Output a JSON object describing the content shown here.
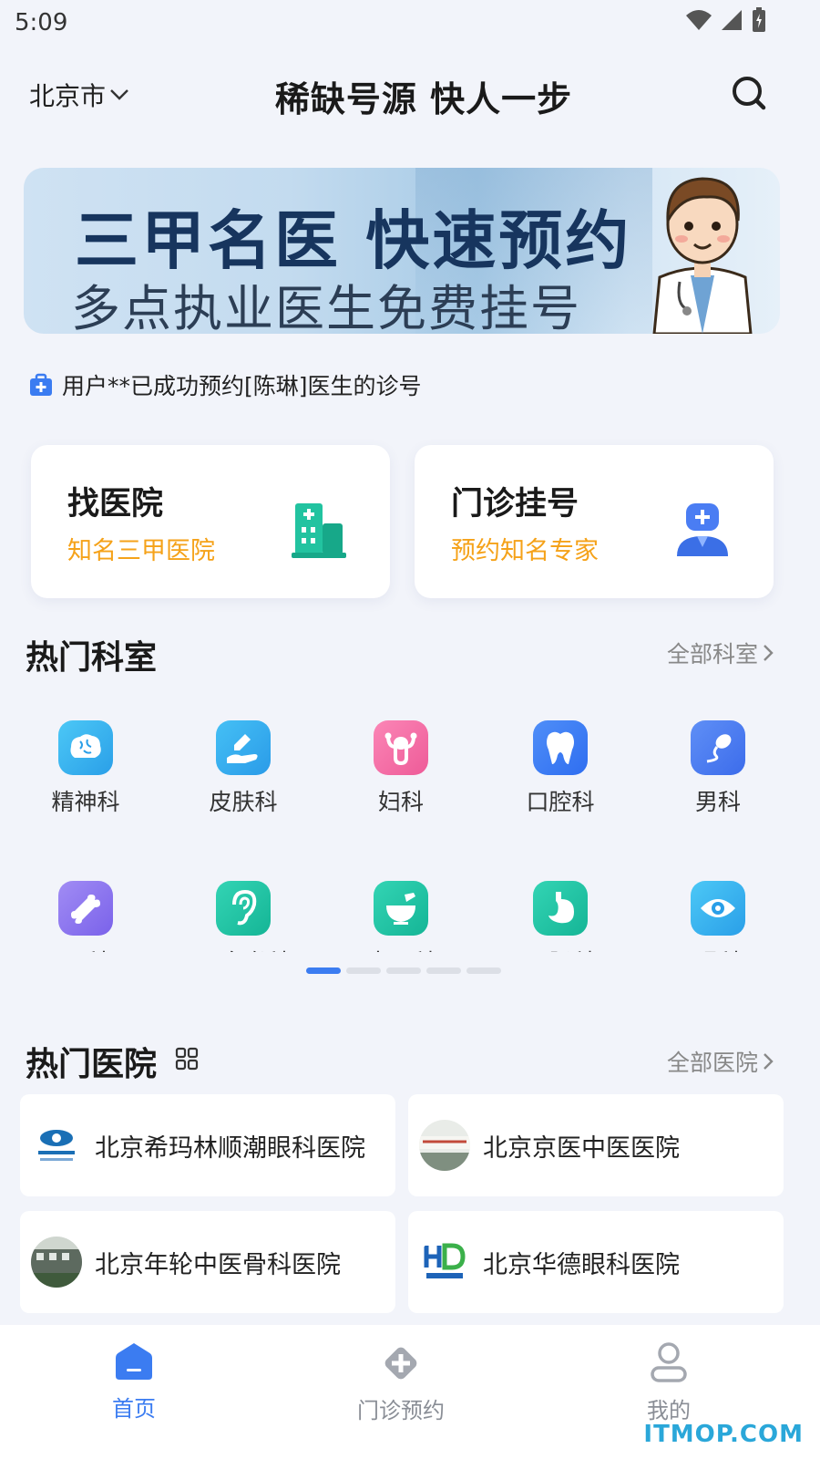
{
  "status_bar": {
    "time": "5:09"
  },
  "header": {
    "city": "北京市",
    "title": "稀缺号源 快人一步"
  },
  "banner": {
    "headline": "三甲名医 快速预约",
    "subline": "多点执业医生免费挂号"
  },
  "notice": {
    "text": "用户**已成功预约[陈琳]医生的诊号"
  },
  "quick_cards": [
    {
      "title": "找医院",
      "subtitle": "知名三甲医院",
      "icon": "hospital-building-icon"
    },
    {
      "title": "门诊挂号",
      "subtitle": "预约知名专家",
      "icon": "doctor-icon"
    }
  ],
  "departments": {
    "title": "热门科室",
    "more": "全部科室",
    "items": [
      {
        "label": "精神科",
        "icon": "brain-icon",
        "color": "#34b4f0"
      },
      {
        "label": "皮肤科",
        "icon": "skin-icon",
        "color": "#2fa8ea"
      },
      {
        "label": "妇科",
        "icon": "uterus-icon",
        "color": "#f46da3"
      },
      {
        "label": "口腔科",
        "icon": "tooth-icon",
        "color": "#3d7df5"
      },
      {
        "label": "男科",
        "icon": "sperm-icon",
        "color": "#4a7df3"
      },
      {
        "label": "骨科",
        "icon": "bone-icon",
        "color": "#8c73ee"
      },
      {
        "label": "耳鼻喉科",
        "icon": "ear-icon",
        "color": "#1fc3a5"
      },
      {
        "label": "中医科",
        "icon": "mortar-icon",
        "color": "#1fc3a5"
      },
      {
        "label": "胃肠科",
        "icon": "stomach-icon",
        "color": "#1fc3a5"
      },
      {
        "label": "眼科",
        "icon": "eye-icon",
        "color": "#38b8f2"
      }
    ],
    "page_count": 5,
    "active_page": 0
  },
  "hospitals": {
    "title": "热门医院",
    "more": "全部医院",
    "items": [
      {
        "name": "北京希玛林顺潮眼科医院"
      },
      {
        "name": "北京京医中医医院"
      },
      {
        "name": "北京年轮中医骨科医院"
      },
      {
        "name": "北京华德眼科医院"
      }
    ]
  },
  "bottom_nav": [
    {
      "label": "首页",
      "icon": "home-icon",
      "active": true
    },
    {
      "label": "门诊预约",
      "icon": "medical-cross-icon",
      "active": false
    },
    {
      "label": "我的",
      "icon": "user-icon",
      "active": false
    }
  ],
  "watermark": "ITMOP.COM",
  "colors": {
    "accent": "#3b7cf1",
    "orange": "#f5a219",
    "teal": "#1fc3a5",
    "background": "#f2f4fa"
  }
}
